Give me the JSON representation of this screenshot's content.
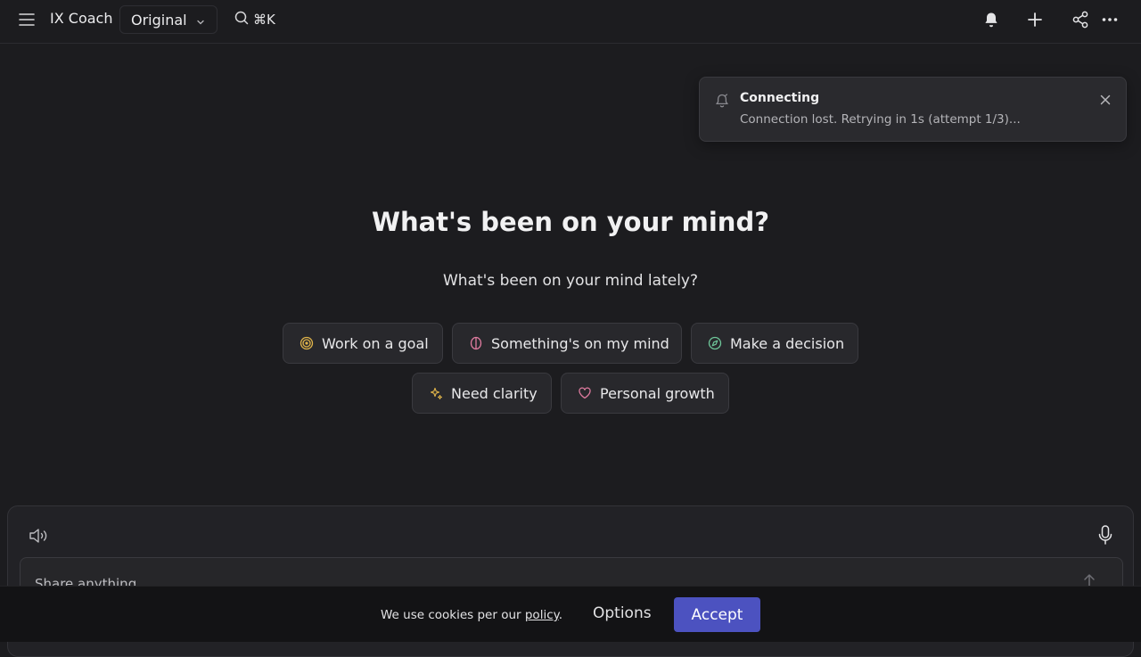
{
  "header": {
    "brand": "IX Coach",
    "model_selected": "Original",
    "search_shortcut": "⌘K"
  },
  "toast": {
    "title": "Connecting",
    "message": "Connection lost. Retrying in 1s (attempt 1/3)..."
  },
  "main": {
    "headline": "What's been on your mind?",
    "subhead": "What's been on your mind lately?",
    "chips": [
      {
        "label": "Work on a goal",
        "icon": "target-icon",
        "color": "#e0b44a"
      },
      {
        "label": "Something's on my mind",
        "icon": "brain-icon",
        "color": "#e07ca0"
      },
      {
        "label": "Make a decision",
        "icon": "compass-icon",
        "color": "#6fc79a"
      },
      {
        "label": "Need clarity",
        "icon": "sparkles-icon",
        "color": "#e0b44a"
      },
      {
        "label": "Personal growth",
        "icon": "heart-icon",
        "color": "#e07ca0"
      }
    ]
  },
  "composer": {
    "placeholder": "Share anything"
  },
  "cookie": {
    "text_prefix": "We use cookies per our ",
    "link_label": "policy",
    "text_suffix": ".",
    "options_label": "Options",
    "accept_label": "Accept"
  },
  "colors": {
    "background": "#1c1c1f",
    "accent": "#4c52c0"
  }
}
